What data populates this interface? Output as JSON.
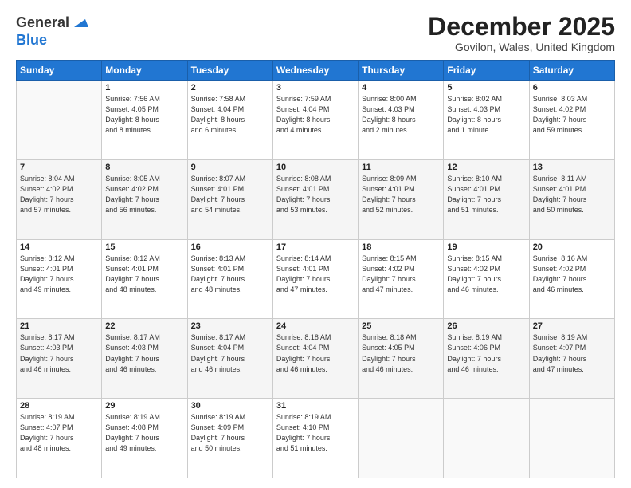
{
  "logo": {
    "line1": "General",
    "line2": "Blue"
  },
  "title": "December 2025",
  "location": "Govilon, Wales, United Kingdom",
  "days_header": [
    "Sunday",
    "Monday",
    "Tuesday",
    "Wednesday",
    "Thursday",
    "Friday",
    "Saturday"
  ],
  "weeks": [
    [
      {
        "day": "",
        "info": ""
      },
      {
        "day": "1",
        "info": "Sunrise: 7:56 AM\nSunset: 4:05 PM\nDaylight: 8 hours\nand 8 minutes."
      },
      {
        "day": "2",
        "info": "Sunrise: 7:58 AM\nSunset: 4:04 PM\nDaylight: 8 hours\nand 6 minutes."
      },
      {
        "day": "3",
        "info": "Sunrise: 7:59 AM\nSunset: 4:04 PM\nDaylight: 8 hours\nand 4 minutes."
      },
      {
        "day": "4",
        "info": "Sunrise: 8:00 AM\nSunset: 4:03 PM\nDaylight: 8 hours\nand 2 minutes."
      },
      {
        "day": "5",
        "info": "Sunrise: 8:02 AM\nSunset: 4:03 PM\nDaylight: 8 hours\nand 1 minute."
      },
      {
        "day": "6",
        "info": "Sunrise: 8:03 AM\nSunset: 4:02 PM\nDaylight: 7 hours\nand 59 minutes."
      }
    ],
    [
      {
        "day": "7",
        "info": "Sunrise: 8:04 AM\nSunset: 4:02 PM\nDaylight: 7 hours\nand 57 minutes."
      },
      {
        "day": "8",
        "info": "Sunrise: 8:05 AM\nSunset: 4:02 PM\nDaylight: 7 hours\nand 56 minutes."
      },
      {
        "day": "9",
        "info": "Sunrise: 8:07 AM\nSunset: 4:01 PM\nDaylight: 7 hours\nand 54 minutes."
      },
      {
        "day": "10",
        "info": "Sunrise: 8:08 AM\nSunset: 4:01 PM\nDaylight: 7 hours\nand 53 minutes."
      },
      {
        "day": "11",
        "info": "Sunrise: 8:09 AM\nSunset: 4:01 PM\nDaylight: 7 hours\nand 52 minutes."
      },
      {
        "day": "12",
        "info": "Sunrise: 8:10 AM\nSunset: 4:01 PM\nDaylight: 7 hours\nand 51 minutes."
      },
      {
        "day": "13",
        "info": "Sunrise: 8:11 AM\nSunset: 4:01 PM\nDaylight: 7 hours\nand 50 minutes."
      }
    ],
    [
      {
        "day": "14",
        "info": "Sunrise: 8:12 AM\nSunset: 4:01 PM\nDaylight: 7 hours\nand 49 minutes."
      },
      {
        "day": "15",
        "info": "Sunrise: 8:12 AM\nSunset: 4:01 PM\nDaylight: 7 hours\nand 48 minutes."
      },
      {
        "day": "16",
        "info": "Sunrise: 8:13 AM\nSunset: 4:01 PM\nDaylight: 7 hours\nand 48 minutes."
      },
      {
        "day": "17",
        "info": "Sunrise: 8:14 AM\nSunset: 4:01 PM\nDaylight: 7 hours\nand 47 minutes."
      },
      {
        "day": "18",
        "info": "Sunrise: 8:15 AM\nSunset: 4:02 PM\nDaylight: 7 hours\nand 47 minutes."
      },
      {
        "day": "19",
        "info": "Sunrise: 8:15 AM\nSunset: 4:02 PM\nDaylight: 7 hours\nand 46 minutes."
      },
      {
        "day": "20",
        "info": "Sunrise: 8:16 AM\nSunset: 4:02 PM\nDaylight: 7 hours\nand 46 minutes."
      }
    ],
    [
      {
        "day": "21",
        "info": "Sunrise: 8:17 AM\nSunset: 4:03 PM\nDaylight: 7 hours\nand 46 minutes."
      },
      {
        "day": "22",
        "info": "Sunrise: 8:17 AM\nSunset: 4:03 PM\nDaylight: 7 hours\nand 46 minutes."
      },
      {
        "day": "23",
        "info": "Sunrise: 8:17 AM\nSunset: 4:04 PM\nDaylight: 7 hours\nand 46 minutes."
      },
      {
        "day": "24",
        "info": "Sunrise: 8:18 AM\nSunset: 4:04 PM\nDaylight: 7 hours\nand 46 minutes."
      },
      {
        "day": "25",
        "info": "Sunrise: 8:18 AM\nSunset: 4:05 PM\nDaylight: 7 hours\nand 46 minutes."
      },
      {
        "day": "26",
        "info": "Sunrise: 8:19 AM\nSunset: 4:06 PM\nDaylight: 7 hours\nand 46 minutes."
      },
      {
        "day": "27",
        "info": "Sunrise: 8:19 AM\nSunset: 4:07 PM\nDaylight: 7 hours\nand 47 minutes."
      }
    ],
    [
      {
        "day": "28",
        "info": "Sunrise: 8:19 AM\nSunset: 4:07 PM\nDaylight: 7 hours\nand 48 minutes."
      },
      {
        "day": "29",
        "info": "Sunrise: 8:19 AM\nSunset: 4:08 PM\nDaylight: 7 hours\nand 49 minutes."
      },
      {
        "day": "30",
        "info": "Sunrise: 8:19 AM\nSunset: 4:09 PM\nDaylight: 7 hours\nand 50 minutes."
      },
      {
        "day": "31",
        "info": "Sunrise: 8:19 AM\nSunset: 4:10 PM\nDaylight: 7 hours\nand 51 minutes."
      },
      {
        "day": "",
        "info": ""
      },
      {
        "day": "",
        "info": ""
      },
      {
        "day": "",
        "info": ""
      }
    ]
  ]
}
